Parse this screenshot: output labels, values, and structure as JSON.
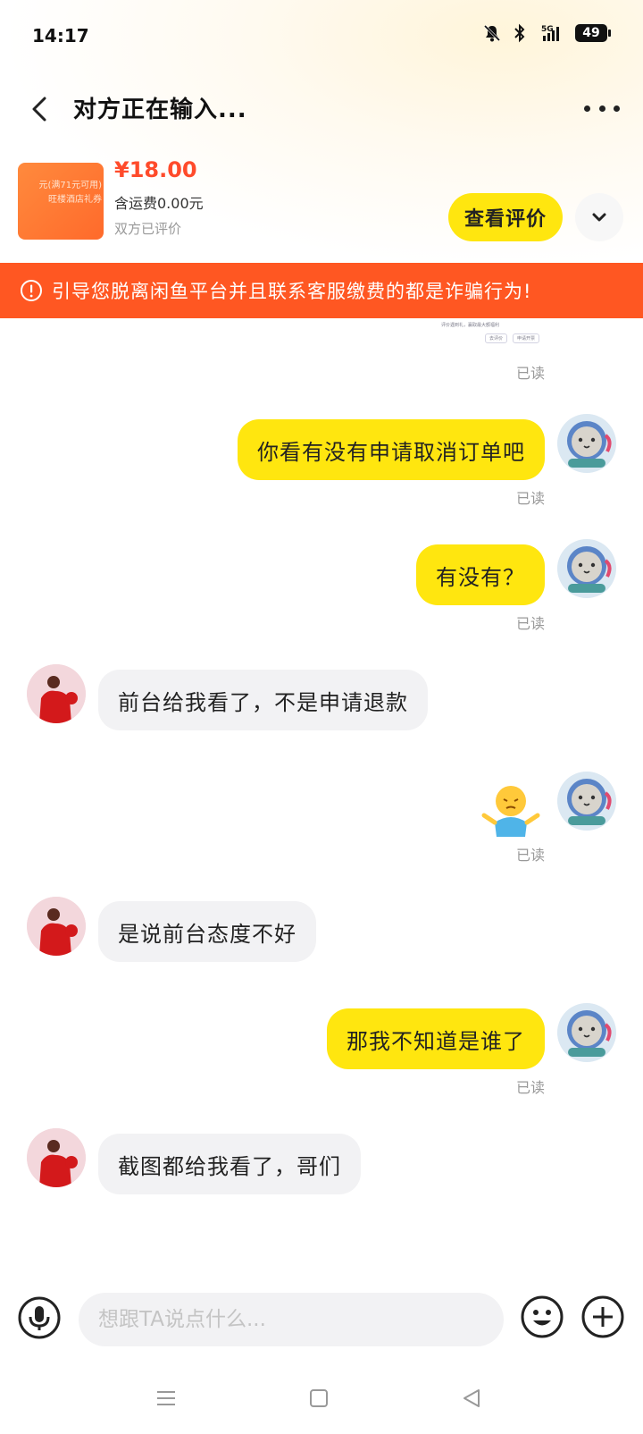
{
  "status_bar": {
    "time": "14:17",
    "network": "5G",
    "battery": "49"
  },
  "nav": {
    "title": "对方正在输入..."
  },
  "product": {
    "thumb_text": "元(满71元可用)\n旺楼酒店礼券",
    "price": "¥18.00",
    "shipping": "含运费0.00元",
    "status": "双方已评价",
    "review_button": "查看评价"
  },
  "warning": {
    "text": "引导您脱离闲鱼平台并且联系客服缴费的都是诈骗行为!"
  },
  "chat": {
    "mini_card": {
      "line1": "评价遇到礼，赢取最大额福利",
      "btn1": "去评价",
      "btn2": "申请开票",
      "btn3": "去评价"
    },
    "read_label": "已读",
    "messages": [
      {
        "from": "me",
        "text": "你看有没有申请取消订单吧"
      },
      {
        "from": "me",
        "text": "有没有？"
      },
      {
        "from": "them",
        "text": "前台给我看了，不是申请退款"
      },
      {
        "from": "me",
        "sticker": "shrug-sticker"
      },
      {
        "from": "them",
        "text": "是说前台态度不好"
      },
      {
        "from": "me",
        "text": "那我不知道是谁了"
      },
      {
        "from": "them",
        "text": "截图都给我看了，哥们"
      }
    ]
  },
  "input": {
    "placeholder": "想跟TA说点什么..."
  },
  "colors": {
    "accent_yellow": "#ffe60f",
    "warning_orange": "#ff5722",
    "price_red": "#ff4b2b"
  }
}
